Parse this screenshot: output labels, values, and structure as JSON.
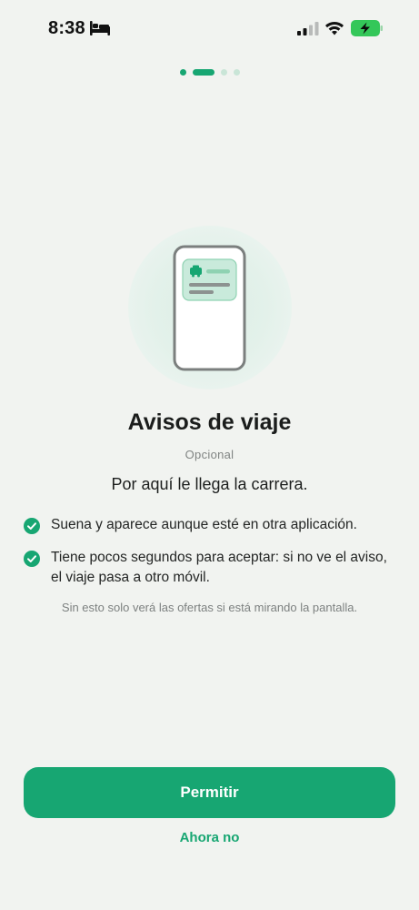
{
  "status_bar": {
    "time": "8:38",
    "icons": [
      "bed-icon",
      "signal-icon",
      "wifi-icon",
      "battery-charging-icon"
    ]
  },
  "pager": {
    "total": 4,
    "current": 2
  },
  "onboarding": {
    "title": "Avisos de viaje",
    "badge": "Opcional",
    "subtitle": "Por aquí le llega la carrera.",
    "benefits": [
      "Suena y aparece aunque esté en otra aplicación.",
      "Tiene pocos segundos para aceptar: si no ve el aviso, el viaje pasa a otro móvil."
    ],
    "note": "Sin esto solo verá las ofertas si está mirando la pantalla."
  },
  "actions": {
    "primary_label": "Permitir",
    "secondary_label": "Ahora no"
  },
  "colors": {
    "accent": "#17a672",
    "background": "#f1f3f0",
    "battery": "#34c759"
  }
}
